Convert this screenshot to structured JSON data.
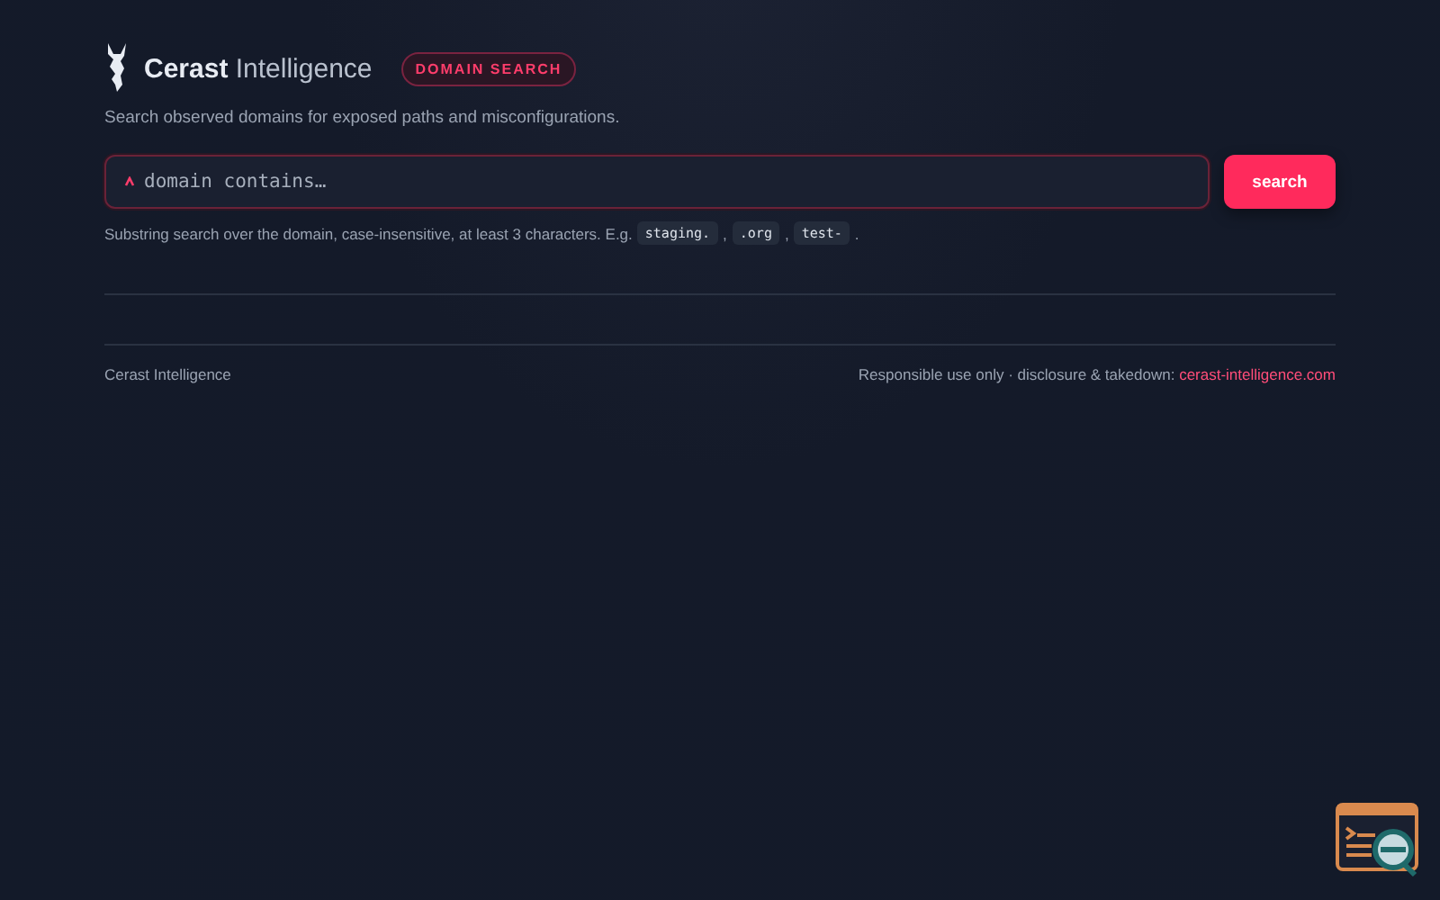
{
  "header": {
    "brand_bold": "Cerast",
    "brand_light": "Intelligence",
    "badge": "DOMAIN SEARCH",
    "tagline": "Search observed domains for exposed paths and misconfigurations."
  },
  "search": {
    "placeholder": "domain contains…",
    "button": "search"
  },
  "hint": {
    "text": "Substring search over the domain, case-insensitive, at least 3 characters. E.g.",
    "examples": [
      {
        "code": "staging.",
        "after": ","
      },
      {
        "code": ".org",
        "after": ","
      },
      {
        "code": "test-",
        "after": "."
      }
    ]
  },
  "footer": {
    "left": "Cerast Intelligence",
    "right": "Responsible use only · disclosure & takedown:",
    "link": "cerast-intelligence.com"
  }
}
